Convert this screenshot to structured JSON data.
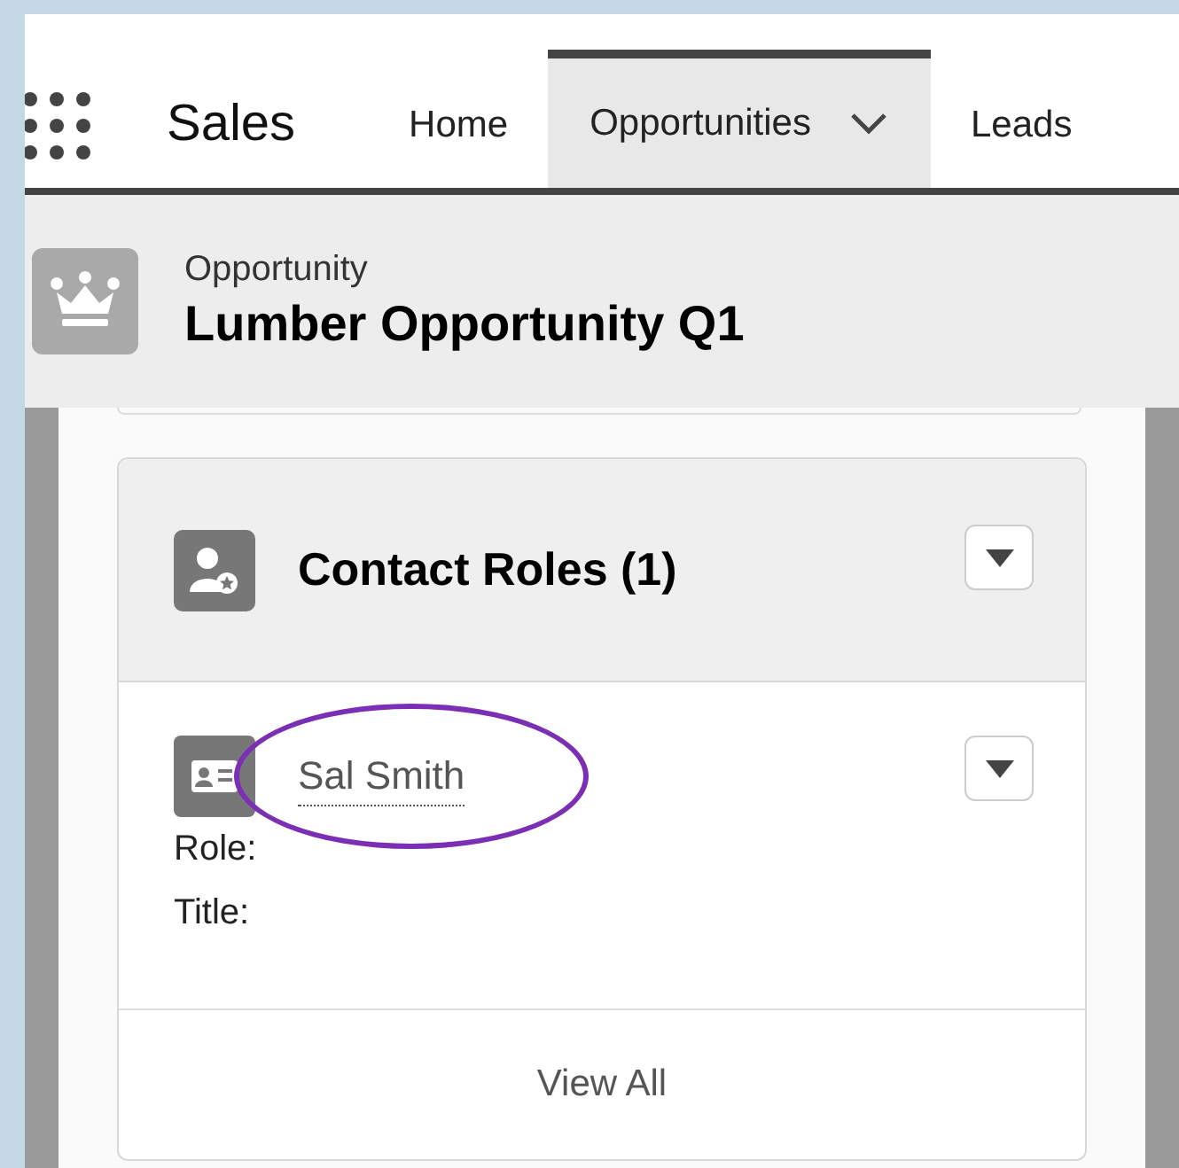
{
  "app_name": "Sales",
  "nav_tabs": [
    {
      "label": "Home",
      "selected": false,
      "has_menu": false
    },
    {
      "label": "Opportunities",
      "selected": true,
      "has_menu": true
    },
    {
      "label": "Leads",
      "selected": false,
      "has_menu": false
    }
  ],
  "record_header": {
    "object_type": "Opportunity",
    "title": "Lumber Opportunity Q1"
  },
  "related_list": {
    "title": "Contact Roles (1)",
    "records": [
      {
        "name": "Sal Smith",
        "fields": [
          "Role:",
          "Title:"
        ],
        "highlighted": true
      }
    ],
    "footer_link": "View All"
  }
}
